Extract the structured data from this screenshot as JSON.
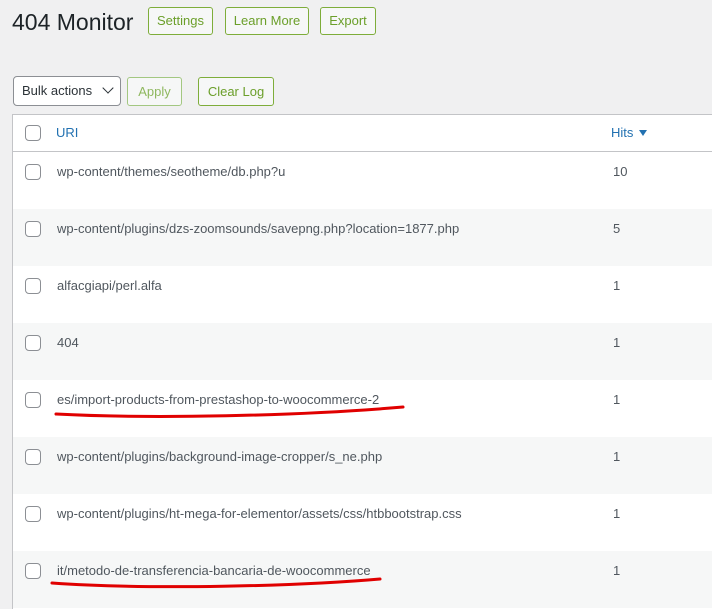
{
  "header": {
    "title": "404 Monitor",
    "settings_label": "Settings",
    "learn_more_label": "Learn More",
    "export_label": "Export"
  },
  "toolbar": {
    "bulk_actions_value": "Bulk actions",
    "apply_label": "Apply",
    "clear_log_label": "Clear Log"
  },
  "table": {
    "columns": {
      "uri": "URI",
      "hits": "Hits"
    },
    "rows": [
      {
        "uri": "wp-content/themes/seotheme/db.php?u",
        "hits": "10"
      },
      {
        "uri": "wp-content/plugins/dzs-zoomsounds/savepng.php?location=1877.php",
        "hits": "5"
      },
      {
        "uri": "alfacgiapi/perl.alfa",
        "hits": "1"
      },
      {
        "uri": "404",
        "hits": "1"
      },
      {
        "uri": "es/import-products-from-prestashop-to-woocommerce-2",
        "hits": "1"
      },
      {
        "uri": "wp-content/plugins/background-image-cropper/s_ne.php",
        "hits": "1"
      },
      {
        "uri": "wp-content/plugins/ht-mega-for-elementor/assets/css/htbbootstrap.css",
        "hits": "1"
      },
      {
        "uri": "it/metodo-de-transferencia-bancaria-de-woocommerce",
        "hits": "1"
      }
    ]
  },
  "colors": {
    "accent_green": "#6b9f2a",
    "link_blue": "#2271b1",
    "annotation_red": "#e00000"
  },
  "icons": [
    "chevron-down-icon",
    "sort-desc-icon",
    "red-underline-annotation"
  ]
}
